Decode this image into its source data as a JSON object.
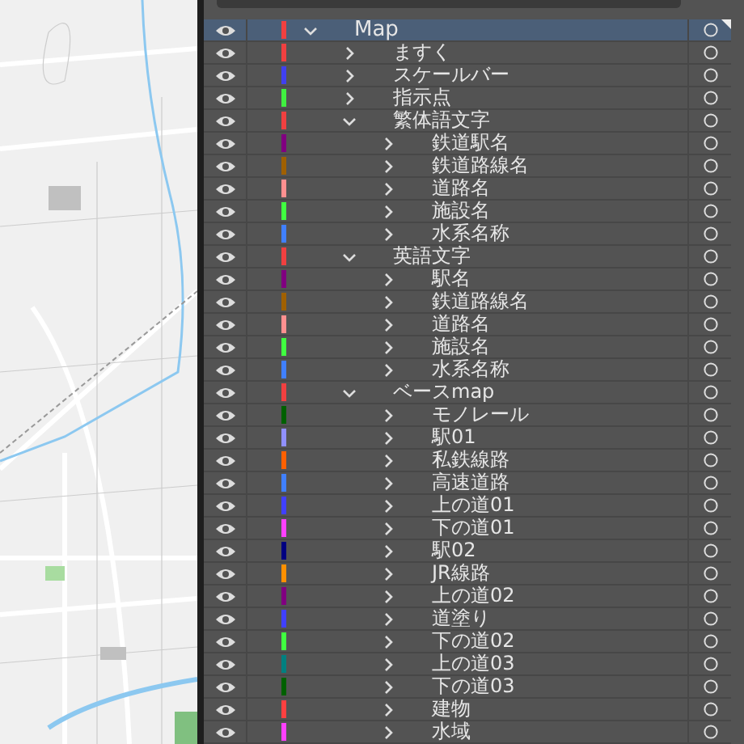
{
  "layers": [
    {
      "name": "Map",
      "color": "#f04040",
      "selected": true,
      "expanded": true,
      "children": [
        {
          "name": "ますく",
          "color": "#f04040",
          "selected": false,
          "expanded": false
        },
        {
          "name": "スケールバー",
          "color": "#4040f0",
          "selected": false,
          "expanded": false
        },
        {
          "name": "指示点",
          "color": "#40f040",
          "selected": false,
          "expanded": false
        },
        {
          "name": "繁体語文字",
          "color": "#f04040",
          "selected": false,
          "expanded": true,
          "children": [
            {
              "name": "鉄道駅名",
              "color": "#800080",
              "selected": false,
              "expanded": false
            },
            {
              "name": "鉄道路線名",
              "color": "#a06000",
              "selected": false,
              "expanded": false
            },
            {
              "name": "道路名",
              "color": "#ff9090",
              "selected": false,
              "expanded": false
            },
            {
              "name": "施設名",
              "color": "#40ff40",
              "selected": false,
              "expanded": false
            },
            {
              "name": "水系名称",
              "color": "#4080ff",
              "selected": false,
              "expanded": false
            }
          ]
        },
        {
          "name": "英語文字",
          "color": "#f04040",
          "selected": false,
          "expanded": true,
          "children": [
            {
              "name": "駅名",
              "color": "#800080",
              "selected": false,
              "expanded": false
            },
            {
              "name": "鉄道路線名",
              "color": "#a06000",
              "selected": false,
              "expanded": false
            },
            {
              "name": "道路名",
              "color": "#ff9090",
              "selected": false,
              "expanded": false
            },
            {
              "name": "施設名",
              "color": "#40ff40",
              "selected": false,
              "expanded": false
            },
            {
              "name": "水系名称",
              "color": "#4080ff",
              "selected": false,
              "expanded": false
            }
          ]
        },
        {
          "name": "ベースmap",
          "color": "#f04040",
          "selected": false,
          "expanded": true,
          "children": [
            {
              "name": "モノレール",
              "color": "#006000",
              "selected": false,
              "expanded": false
            },
            {
              "name": "駅01",
              "color": "#9090ff",
              "selected": false,
              "expanded": false
            },
            {
              "name": "私鉄線路",
              "color": "#ff6000",
              "selected": false,
              "expanded": false
            },
            {
              "name": "高速道路",
              "color": "#4080ff",
              "selected": false,
              "expanded": false
            },
            {
              "name": "上の道01",
              "color": "#4040ff",
              "selected": false,
              "expanded": false
            },
            {
              "name": "下の道01",
              "color": "#ff40ff",
              "selected": false,
              "expanded": false
            },
            {
              "name": "駅02",
              "color": "#000080",
              "selected": false,
              "expanded": false
            },
            {
              "name": "JR線路",
              "color": "#ff9000",
              "selected": false,
              "expanded": false
            },
            {
              "name": "上の道02",
              "color": "#800080",
              "selected": false,
              "expanded": false
            },
            {
              "name": "道塗り",
              "color": "#4040ff",
              "selected": false,
              "expanded": false
            },
            {
              "name": "下の道02",
              "color": "#40ff40",
              "selected": false,
              "expanded": false
            },
            {
              "name": "上の道03",
              "color": "#008080",
              "selected": false,
              "expanded": false
            },
            {
              "name": "下の道03",
              "color": "#006000",
              "selected": false,
              "expanded": false
            },
            {
              "name": "建物",
              "color": "#ff4040",
              "selected": false,
              "expanded": false
            },
            {
              "name": "水域",
              "color": "#ff40ff",
              "selected": false,
              "expanded": false
            }
          ]
        }
      ]
    }
  ]
}
